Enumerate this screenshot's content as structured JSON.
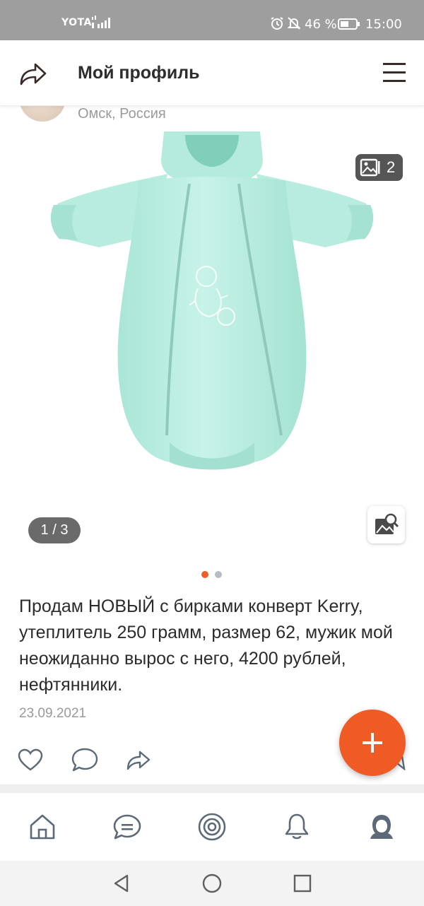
{
  "status_bar": {
    "carrier": "YOTA",
    "battery_percent": "46 %",
    "time": "15:00"
  },
  "header": {
    "title": "Мой профиль",
    "icons": {
      "left": "share-icon",
      "right": "menu-icon"
    }
  },
  "profile": {
    "location": "Омск, Россия"
  },
  "gallery": {
    "photo_count": "2",
    "page_indicator": "1 / 3",
    "dots_total": 2,
    "dots_active": 1,
    "photo_description_icon": "green-baby-sleep-bag"
  },
  "post": {
    "text": "Продам НОВЫЙ с бирками конверт Kerry, утеплитель 250 грамм, размер 62, мужик мой неожиданно вырос с него, 4200 рублей, нефтянники.",
    "date": "23.09.2021"
  },
  "actions": [
    "heart-icon",
    "comment-icon",
    "share-icon"
  ],
  "bottom_nav": [
    "home-icon",
    "messages-icon",
    "discover-icon",
    "notifications-icon",
    "profile-icon"
  ],
  "colors": {
    "accent": "#f05a24",
    "status_bar": "#9e9e9e",
    "dot_active": "#ee5d28",
    "dot_inactive": "#b7bcc6",
    "product": "#bff0e3"
  }
}
